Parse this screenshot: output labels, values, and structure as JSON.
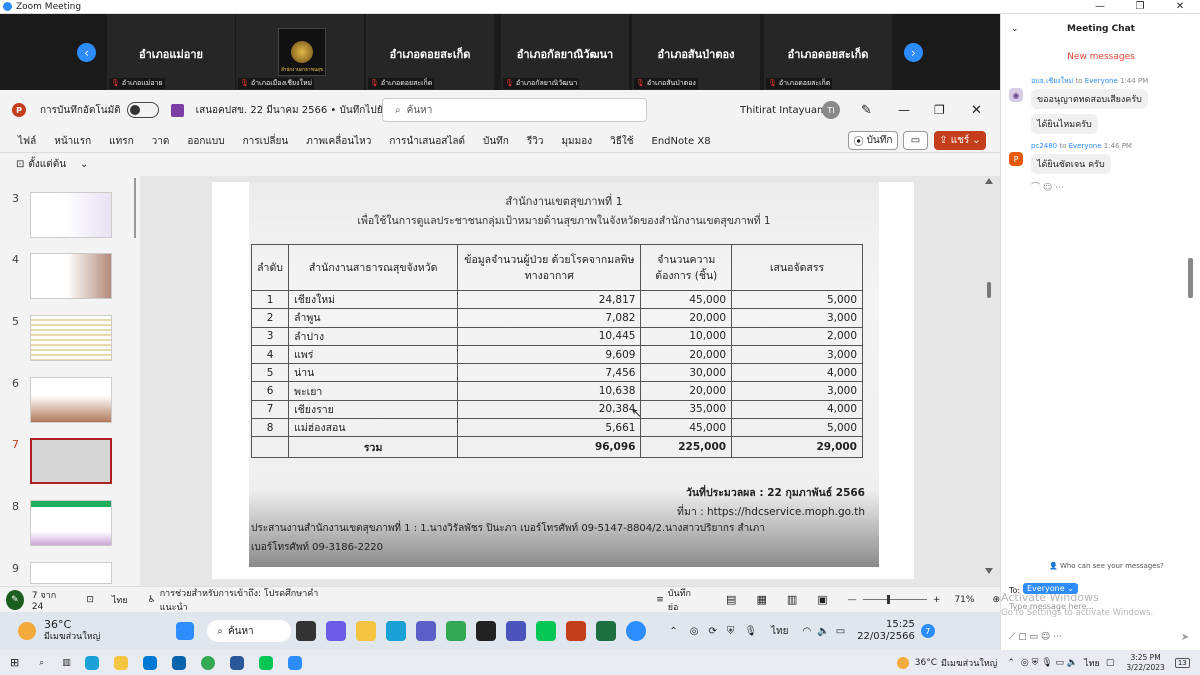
{
  "zoom": {
    "title": "Zoom Meeting",
    "window_controls": [
      "—",
      "❐",
      "✕"
    ],
    "tiles": [
      {
        "name": "อำเภอแม่อาย",
        "label": "อำเภอแม่อาย"
      },
      {
        "name": "",
        "label": "อำเภอเมืองเชียงใหม่",
        "logo_text": "สำนักงานสาธารณสุข"
      },
      {
        "name": "อำเภอดอยสะเก็ด",
        "label": "อำเภอดอยสะเก็ด"
      },
      {
        "name": "อำเภอกัลยาณิวัฒนา",
        "label": "อำเภอกัลยาณิวัฒนา"
      },
      {
        "name": "อำเภอสันป่าตอง",
        "label": "อำเภอสันป่าตอง"
      },
      {
        "name": "อำเภอดอยสะเก็ด",
        "label": "อำเภอดอยสะเก็ด"
      }
    ]
  },
  "ppt": {
    "autosave_label": "การบันทึกอัตโนมัติ",
    "doc_title": "เสนอคปสข. 22 มีนาคม 2566 • บันทึกไปยัง พีซีนี้ ⌄",
    "search_placeholder": "ค้นหา",
    "user_name": "Thitirat Intayuang",
    "user_initials": "TI",
    "menu": [
      "ไฟล์",
      "หน้าแรก",
      "แทรก",
      "วาด",
      "ออกแบบ",
      "การเปลี่ยน",
      "ภาพเคลื่อนไหว",
      "การนำเสนอสไลด์",
      "บันทึก",
      "รีวิว",
      "มุมมอง",
      "วิธีใช้",
      "EndNote X8"
    ],
    "record_label": "บันทึก",
    "share_label": "แชร์",
    "ribbon_label": "ตั้งแต่ต้น",
    "slide_numbers": [
      "3",
      "4",
      "5",
      "6",
      "7",
      "8",
      "9"
    ],
    "status": {
      "slide_count": "7 จาก 24",
      "language": "ไทย",
      "accessibility": "การช่วยสำหรับการเข้าถึง: โปรดศึกษาคำแนะนำ",
      "notes": "บันทึกย่อ",
      "zoom": "71%"
    }
  },
  "slide": {
    "top_text": "สำนักงานเขตสุขภาพที่ 1",
    "subtitle": "เพื่อใช้ในการดูแลประชาชนกลุ่มเป้าหมายด้านสุขภาพในจังหวัดของสำนักงานเขตสุขภาพที่ 1",
    "headers": [
      "ลำดับ",
      "สำนักงานสาธารณสุขจังหวัด",
      "ข้อมูลจำนวนผู้ป่วย ด้วยโรคจากมลพิษทางอากาศ",
      "จำนวนความ ต้องการ (ชิ้น)",
      "เสนอจัดสรร"
    ],
    "rows": [
      [
        "1",
        "เชียงใหม่",
        "24,817",
        "45,000",
        "5,000"
      ],
      [
        "2",
        "ลำพูน",
        "7,082",
        "20,000",
        "3,000"
      ],
      [
        "3",
        "ลำปาง",
        "10,445",
        "10,000",
        "2,000"
      ],
      [
        "4",
        "แพร่",
        "9,609",
        "20,000",
        "3,000"
      ],
      [
        "5",
        "น่าน",
        "7,456",
        "30,000",
        "4,000"
      ],
      [
        "6",
        "พะเยา",
        "10,638",
        "20,000",
        "3,000"
      ],
      [
        "7",
        "เชียงราย",
        "20,384",
        "35,000",
        "4,000"
      ],
      [
        "8",
        "แม่ฮ่องสอน",
        "5,661",
        "45,000",
        "5,000"
      ]
    ],
    "total": [
      "รวม",
      "96,096",
      "225,000",
      "29,000"
    ],
    "date_line": "วันที่ประมวลผล : 22 กุมภาพันธ์ 2566",
    "source_line": "ที่มา : https://hdcservice.moph.go.th",
    "coord_line1": "ประสานงานสำนักงานเขตสุขภาพที่ 1 : 1.นางวิรัลพัชร ปินะภา เบอร์โทรศัพท์ 09-5147-8804/2.นางสาวปริยากร สำเภา",
    "coord_line2": "เบอร์โทรศัพท์ 09-3186-2220"
  },
  "chat": {
    "title": "Meeting Chat",
    "new_messages": "New messages",
    "messages": [
      {
        "sender": "อบจ.เชียงใหม่",
        "to": "to",
        "recipient": "Everyone",
        "time": "1:44 PM",
        "texts": [
          "ขออนุญาตทดสอบเสียงครับ",
          "ได้ยินไหมครับ"
        ]
      },
      {
        "sender": "pc2480",
        "to": "to",
        "recipient": "Everyone",
        "time": "1:46 PM",
        "texts": [
          "ได้ยินชัดเจน ครับ"
        ]
      }
    ],
    "who_can_see": "Who can see your messages?",
    "to_label": "To:",
    "to_value": "Everyone",
    "placeholder": "Type message here...",
    "activate_title": "Activate Windows",
    "activate_sub": "Go to Settings to activate Windows."
  },
  "inner_taskbar": {
    "temp": "36°C",
    "weather": "มีเมฆส่วนใหญ่",
    "search": "ค้นหา",
    "lang": "ไทย",
    "time": "15:25",
    "date": "22/03/2566",
    "badge": "7"
  },
  "win_taskbar": {
    "temp": "36°C",
    "weather": "มีเมฆส่วนใหญ่",
    "lang": "ไทย",
    "time": "3:25 PM",
    "date": "3/22/2023",
    "badge": "13"
  }
}
